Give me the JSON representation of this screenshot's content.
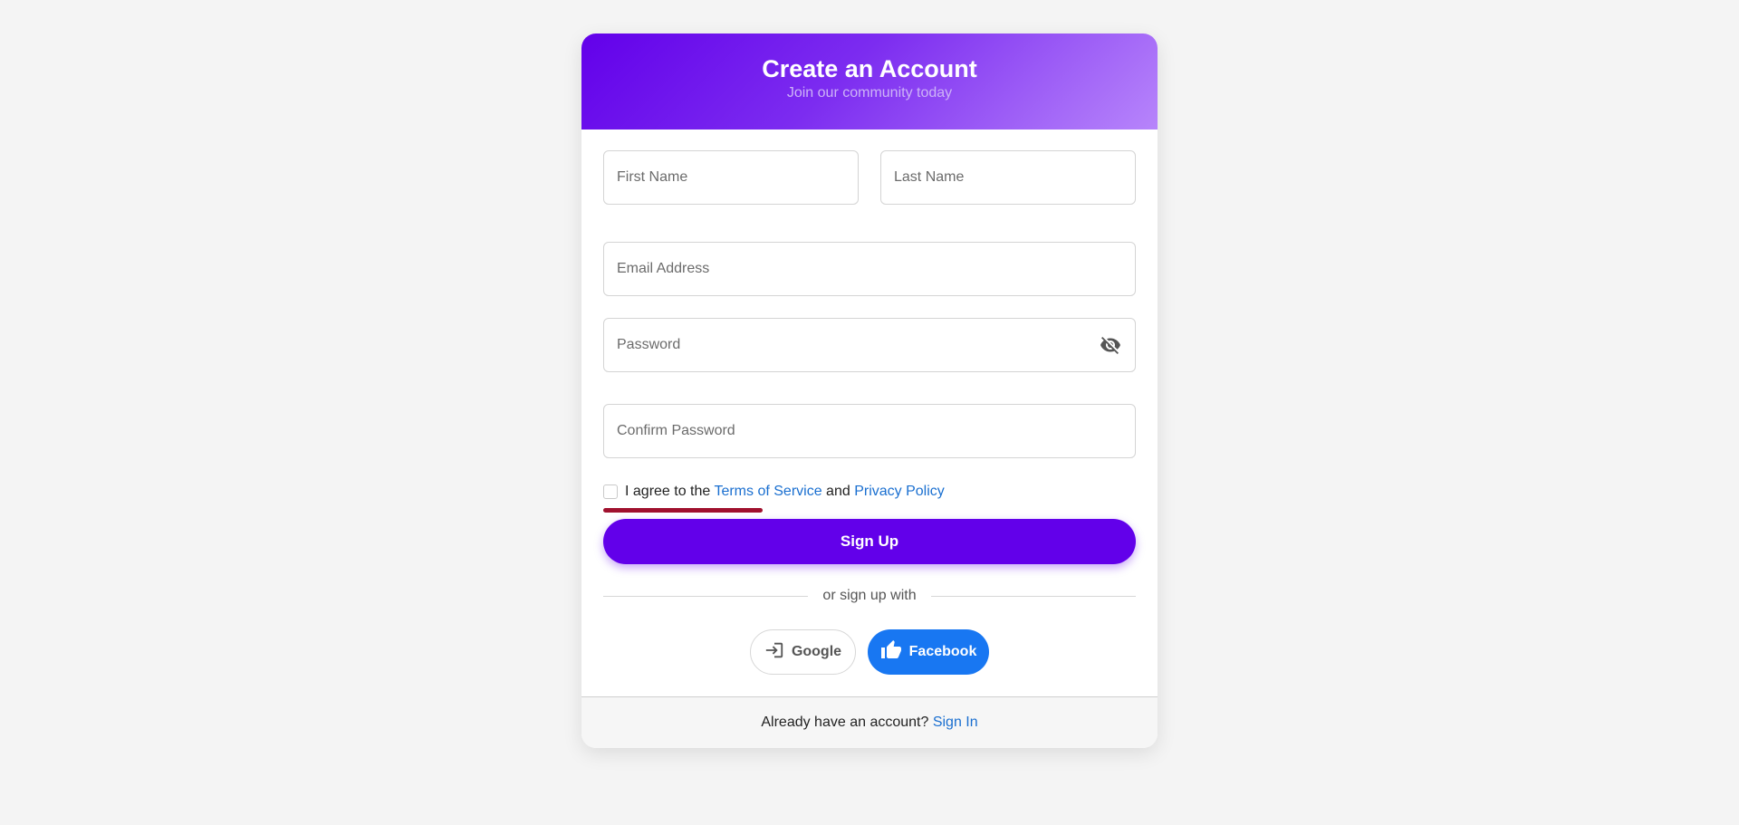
{
  "header": {
    "title": "Create an Account",
    "subtitle": "Join our community today"
  },
  "form": {
    "first_name": {
      "placeholder": "First Name",
      "value": ""
    },
    "last_name": {
      "placeholder": "Last Name",
      "value": ""
    },
    "email": {
      "placeholder": "Email Address",
      "value": ""
    },
    "password": {
      "placeholder": "Password",
      "value": "",
      "toggle_icon": "eye-off-icon"
    },
    "password_strength": {
      "level": 0.3,
      "color": "#a0112e"
    },
    "confirm_password": {
      "placeholder": "Confirm Password",
      "value": ""
    },
    "terms": {
      "checked": false,
      "prefix": "I agree to the ",
      "terms_link": "Terms of Service",
      "conjunction": " and ",
      "privacy_link": "Privacy Policy"
    },
    "submit_label": "Sign Up"
  },
  "social": {
    "divider_label": "or sign up with",
    "google": {
      "label": "Google",
      "icon": "login-icon"
    },
    "facebook": {
      "label": "Facebook",
      "icon": "thumbs-up-icon"
    }
  },
  "footer": {
    "prompt": "Already have an account? ",
    "link": "Sign In"
  },
  "colors": {
    "primary": "#6200ea",
    "header_gradient_end": "#b785fb",
    "link": "#1a6fd0",
    "facebook": "#1877f2"
  }
}
